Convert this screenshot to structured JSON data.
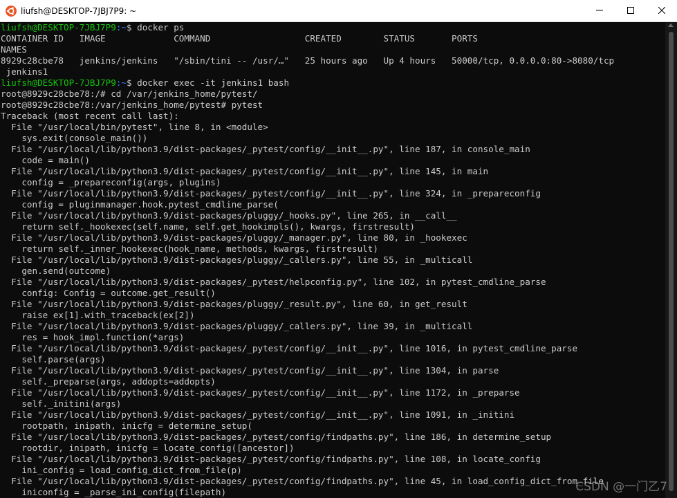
{
  "window": {
    "title": "liufsh@DESKTOP-7JBJ7P9: ~",
    "icon": "ubuntu-icon",
    "controls": [
      "minimize-icon",
      "maximize-icon",
      "close-icon"
    ]
  },
  "colors": {
    "background": "#0c0c0c",
    "text": "#cccccc",
    "prompt_user": "#16c60c",
    "prompt_path": "#3b78ff"
  },
  "terminal": {
    "lines": [
      {
        "user": "liufsh@DESKTOP-7JBJ7P9",
        "path": ":~",
        "cmd": "$ docker ps"
      },
      {
        "text": "CONTAINER ID   IMAGE             COMMAND                  CREATED        STATUS       PORTS"
      },
      {
        "text": "NAMES"
      },
      {
        "text": "8929c28cbe78   jenkins/jenkins   \"/sbin/tini -- /usr/…\"   25 hours ago   Up 4 hours   50000/tcp, 0.0.0.0:80->8080/tcp"
      },
      {
        "text": " jenkins1"
      },
      {
        "user": "liufsh@DESKTOP-7JBJ7P9",
        "path": ":~",
        "cmd": "$ docker exec -it jenkins1 bash"
      },
      {
        "text": "root@8929c28cbe78:/# cd /var/jenkins_home/pytest/"
      },
      {
        "text": "root@8929c28cbe78:/var/jenkins_home/pytest# pytest"
      },
      {
        "text": "Traceback (most recent call last):"
      },
      {
        "text": "  File \"/usr/local/bin/pytest\", line 8, in <module>"
      },
      {
        "text": "    sys.exit(console_main())"
      },
      {
        "text": "  File \"/usr/local/lib/python3.9/dist-packages/_pytest/config/__init__.py\", line 187, in console_main"
      },
      {
        "text": "    code = main()"
      },
      {
        "text": "  File \"/usr/local/lib/python3.9/dist-packages/_pytest/config/__init__.py\", line 145, in main"
      },
      {
        "text": "    config = _prepareconfig(args, plugins)"
      },
      {
        "text": "  File \"/usr/local/lib/python3.9/dist-packages/_pytest/config/__init__.py\", line 324, in _prepareconfig"
      },
      {
        "text": "    config = pluginmanager.hook.pytest_cmdline_parse("
      },
      {
        "text": "  File \"/usr/local/lib/python3.9/dist-packages/pluggy/_hooks.py\", line 265, in __call__"
      },
      {
        "text": "    return self._hookexec(self.name, self.get_hookimpls(), kwargs, firstresult)"
      },
      {
        "text": "  File \"/usr/local/lib/python3.9/dist-packages/pluggy/_manager.py\", line 80, in _hookexec"
      },
      {
        "text": "    return self._inner_hookexec(hook_name, methods, kwargs, firstresult)"
      },
      {
        "text": "  File \"/usr/local/lib/python3.9/dist-packages/pluggy/_callers.py\", line 55, in _multicall"
      },
      {
        "text": "    gen.send(outcome)"
      },
      {
        "text": "  File \"/usr/local/lib/python3.9/dist-packages/_pytest/helpconfig.py\", line 102, in pytest_cmdline_parse"
      },
      {
        "text": "    config: Config = outcome.get_result()"
      },
      {
        "text": "  File \"/usr/local/lib/python3.9/dist-packages/pluggy/_result.py\", line 60, in get_result"
      },
      {
        "text": "    raise ex[1].with_traceback(ex[2])"
      },
      {
        "text": "  File \"/usr/local/lib/python3.9/dist-packages/pluggy/_callers.py\", line 39, in _multicall"
      },
      {
        "text": "    res = hook_impl.function(*args)"
      },
      {
        "text": "  File \"/usr/local/lib/python3.9/dist-packages/_pytest/config/__init__.py\", line 1016, in pytest_cmdline_parse"
      },
      {
        "text": "    self.parse(args)"
      },
      {
        "text": "  File \"/usr/local/lib/python3.9/dist-packages/_pytest/config/__init__.py\", line 1304, in parse"
      },
      {
        "text": "    self._preparse(args, addopts=addopts)"
      },
      {
        "text": "  File \"/usr/local/lib/python3.9/dist-packages/_pytest/config/__init__.py\", line 1172, in _preparse"
      },
      {
        "text": "    self._initini(args)"
      },
      {
        "text": "  File \"/usr/local/lib/python3.9/dist-packages/_pytest/config/__init__.py\", line 1091, in _initini"
      },
      {
        "text": "    rootpath, inipath, inicfg = determine_setup("
      },
      {
        "text": "  File \"/usr/local/lib/python3.9/dist-packages/_pytest/config/findpaths.py\", line 186, in determine_setup"
      },
      {
        "text": "    rootdir, inipath, inicfg = locate_config([ancestor])"
      },
      {
        "text": "  File \"/usr/local/lib/python3.9/dist-packages/_pytest/config/findpaths.py\", line 108, in locate_config"
      },
      {
        "text": "    ini_config = load_config_dict_from_file(p)"
      },
      {
        "text": "  File \"/usr/local/lib/python3.9/dist-packages/_pytest/config/findpaths.py\", line 45, in load_config_dict_from_file"
      },
      {
        "text": "    iniconfig = _parse_ini_config(filepath)"
      }
    ]
  },
  "watermark": "CSDN @一门乙7"
}
